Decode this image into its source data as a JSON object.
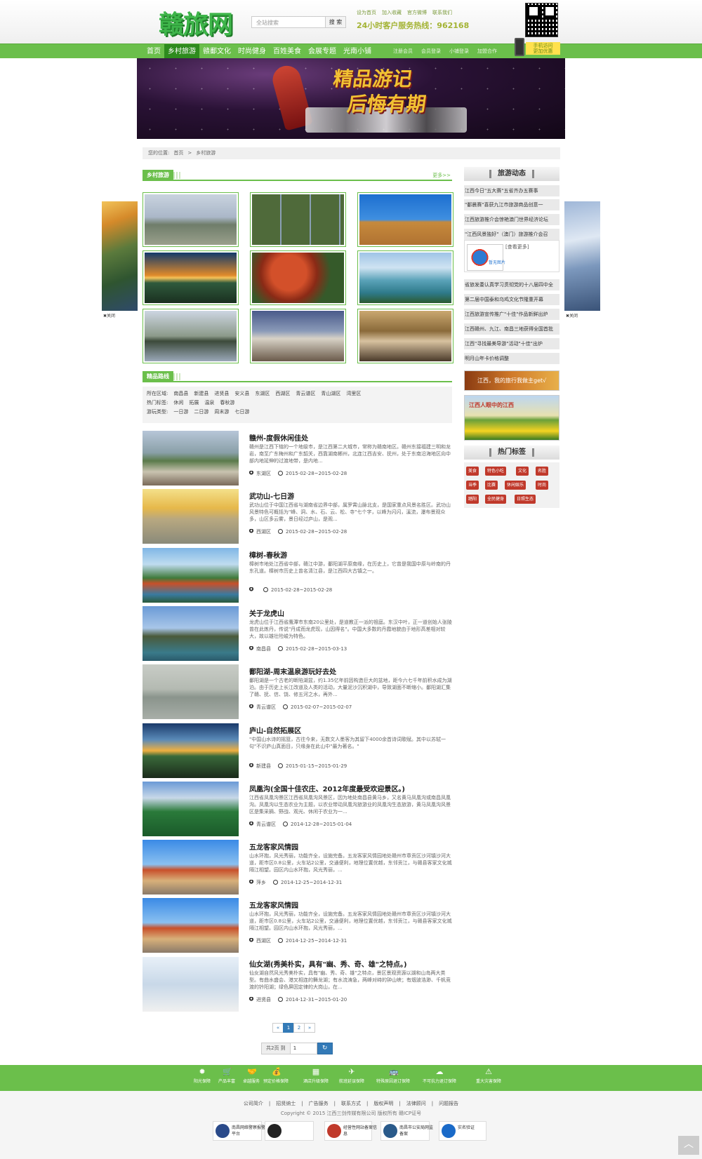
{
  "header": {
    "logo_text": "赣旅网",
    "search_placeholder": "全站搜索",
    "search_button": "搜 索",
    "top_links": [
      "设为首页",
      "加入收藏",
      "官方微博",
      "联系我们"
    ],
    "hotline": "24小时客户服务热线：962168",
    "phone_badge": [
      "手机访问",
      "更加优惠"
    ]
  },
  "nav": {
    "items": [
      "首页",
      "乡村旅游",
      "赣鄱文化",
      "时尚健身",
      "百姓美食",
      "会展专题",
      "光南小铺"
    ],
    "active_index": 1,
    "right_links": [
      "注册会员",
      "会员登录",
      "小铺登录",
      "加盟合作"
    ]
  },
  "banner": {
    "line1": "精品游记",
    "line2": "后悔有期"
  },
  "breadcrumb": [
    "您的位置:",
    "首页",
    ">",
    "乡村旅游"
  ],
  "section_rural": {
    "title": "乡村旅游",
    "more": "更多>>"
  },
  "section_routes": {
    "title": "精品路线"
  },
  "filters": [
    {
      "label": "所在区域:",
      "options": [
        "南昌县",
        "新建县",
        "进贤县",
        "安义县",
        "东湖区",
        "西湖区",
        "青云谱区",
        "青山湖区",
        "湾里区"
      ]
    },
    {
      "label": "热门标签:",
      "options": [
        "休闲",
        "拓展",
        "温泉",
        "春秋游"
      ]
    },
    {
      "label": "游玩类型:",
      "options": [
        "一日游",
        "二日游",
        "周末游",
        "七日游"
      ]
    }
  ],
  "articles": [
    {
      "title": "赣州-度假休闲佳处",
      "desc": "赣州是江西下辖的一个地级市，是江西第二大城市，常称为赣南地区。赣州东接福建三明和龙岩，南至广东梅州和广东韶关，西靠湖南郴州，北连江西吉安、抚州，处于东南沿海地区向中部内地延伸的过渡地带，是内地...",
      "area": "东湖区",
      "date": "2015-02-28~2015-02-28"
    },
    {
      "title": "武功山-七日游",
      "desc": "武功山位于中国江西省与湖南省边界中部，属罗霄山脉北支，是国家重点风景名胜区。武功山风景特色可概括为\"峰、洞、水、石、云、松、寺\"七个字，以峰为闪闪，溪流，瀑布景观众多，山区多云雾，景日经过庐山，是观...",
      "area": "西湖区",
      "date": "2015-02-28~2015-02-28"
    },
    {
      "title": "樟树-春秋游",
      "desc": "樟树市地处江西省中部，赣江中游，鄱阳湖平原南缘，在历史上，它曾是我国中原与岭南的丹东孔道。樟树市历史上曾名清江县，是江西四大古镇之一。",
      "area": "",
      "date": "2015-02-28~2015-02-28"
    },
    {
      "title": "关于龙虎山",
      "desc": "龙虎山位于江西省鹰潭市东南20公里处，是道教正一派的祖庭。东汉中叶，正一道创始人张陵曾在此炼丹，传说\"丹成而龙虎现，山因得名\"。中国大多数的丹霞地貌由于地形高差相对较大，故以雄壮险峻为特色。",
      "area": "南昌县",
      "date": "2015-02-28~2015-03-13"
    },
    {
      "title": "鄱阳湖-周末温泉游玩好去处",
      "desc": "鄱阳湖是一个古老的断陷湖盆，约1.35亿年前因构造巨大的盆地，距今六七千年前积水成为湖泊。由于历史上长江改道及人类的活动，大量泥沙沉积湖中，导致湖面不断缩小。鄱阳湖汇集了赣、抚、信、饶、修五河之水，再外...",
      "area": "青云谱区",
      "date": "2015-02-07~2015-02-07"
    },
    {
      "title": "庐山-自然拓展区",
      "desc": "\"中国山水诗的摇篮，古往今来，无数文人墨客为其留下4000余首诗词歌赋。其中以苏轼一句\"不识庐山真面目，只缘身在此山中\"最为著名。\"",
      "area": "新建县",
      "date": "2015-01-15~2015-01-29"
    },
    {
      "title": "凤凰沟(全国十佳农庄、2012年度最受欢迎景区。)",
      "desc": "江西省凤凰沟景区江西省凤凰沟风景区，因为地处南昌县黄马乡，又名黄马凤凰沟或南昌凤凰沟。凤凰沟以生态农业为主题，以农业带动凤凰沟旅游业的凤凰沟生态旅游，黄马凤凰沟风景区是集采摘、野战、观光、休闲于农业为一...",
      "area": "青云谱区",
      "date": "2014-12-28~2015-01-04"
    },
    {
      "title": "五龙客家风情园",
      "desc": "山水环抱，风光秀丽，功能齐全，设施完备。五龙客家风情园地处赣州市章贡区沙河镇沙河大道，距市区0.8公里，火车站2公里，交通便利，地理位置优越，东邻贡江，与赣县客家文化城隔江相望。园区内山水环抱，风光秀丽，...",
      "area": "萍乡",
      "date": "2014-12-25~2014-12-31"
    },
    {
      "title": "五龙客家风情园",
      "desc": "山水环抱，风光秀丽，功能齐全，设施完备。五龙客家风情园地处赣州市章贡区沙河镇沙河大道，距市区0.8公里，火车站2公里，交通便利，地理位置优越，东邻贡江，与赣县客家文化城隔江相望。园区内山水环抱，风光秀丽，...",
      "area": "西湖区",
      "date": "2014-12-25~2014-12-31"
    },
    {
      "title": "仙女湖(秀美朴实，具有\"幽、秀、奇、雄\"之特点。)",
      "desc": "仙女湖自然风光秀美朴实，具有\"幽、秀、奇、雄\"之特点，景区景观资源以湖和山岛两大类型。有曲水盛会、港叉相连的舞龙湖；有水流涛急，两峰对峙的钟山峡；有烟波浩渺、千帆竞渡的钤阳湖；绿色屏因定律的大岗山，在...",
      "area": "进贤县",
      "date": "2014-12-31~2015-01-20"
    }
  ],
  "pager": {
    "prev": "«",
    "pages": [
      "1",
      "2"
    ],
    "next": "»",
    "active": "1",
    "total_label": "共2页 到",
    "jump_value": "1"
  },
  "sidebar": {
    "news_title": "旅游动态",
    "news": [
      "江西今日\"五大赛\"五省齐办五赛事",
      "\"鄱晨赛\"喜获九江市旅游商品创意一",
      "江西旅游推介会惊艳澳门世界经济论坛",
      "\"江西风景独好\"（澳门）旅游推介会召",
      "省旅发委认真学习贯彻党的十八届四中全",
      "第二届中国泰和乌鸡文化节隆重开幕",
      "江西旅游宣传推广\"十佳\"作品新鲜出炉",
      "江西赣州、九江、南昌三地获得全国首批",
      "江西\"寻找最美导游\"活动\"十佳\"出炉",
      "明月山年卡价格调整"
    ],
    "thumb_label": "[查看更多]",
    "thumb_caption": "暂无图片",
    "ad1_text": "江西，我的旅行我做主get√",
    "ad2_text": "江西人眼中的江西",
    "tags_title": "热门标签",
    "tags": [
      "美食",
      "特色小吃",
      "文化",
      "名胜",
      "当季",
      "比赛",
      "休闲娱乐",
      "时尚",
      "踏阳",
      "全民健身",
      "日照生态"
    ]
  },
  "float": {
    "close_label": "✖关闭"
  },
  "footer": {
    "features": [
      "阳光保障",
      "产品丰富",
      "卓越服务",
      "预定价格保障",
      "酒店升级保障",
      "航班延误保障",
      "特殊原因退订保障",
      "不可抗力退订保障",
      "重大灾害保障"
    ],
    "links": [
      "公司简介",
      "|",
      "招贤纳士",
      "|",
      "广告服务",
      "|",
      "联系方式",
      "|",
      "版权声明",
      "|",
      "法律顾问",
      "|",
      "问题报告"
    ],
    "copyright": "Copyright © 2015 江西三剑传媒有限公司 版权所有 赣ICP证号",
    "badges": [
      "南昌网络警察报警平台",
      "",
      "经营性网站备案信息",
      "南昌市公安局网监备案",
      "实名验证"
    ]
  },
  "colors": {
    "brand_green": "#6bbf4b",
    "dark_green": "#2e8b1e",
    "tag_red": "#c0392b",
    "pager_blue": "#337ab7"
  }
}
